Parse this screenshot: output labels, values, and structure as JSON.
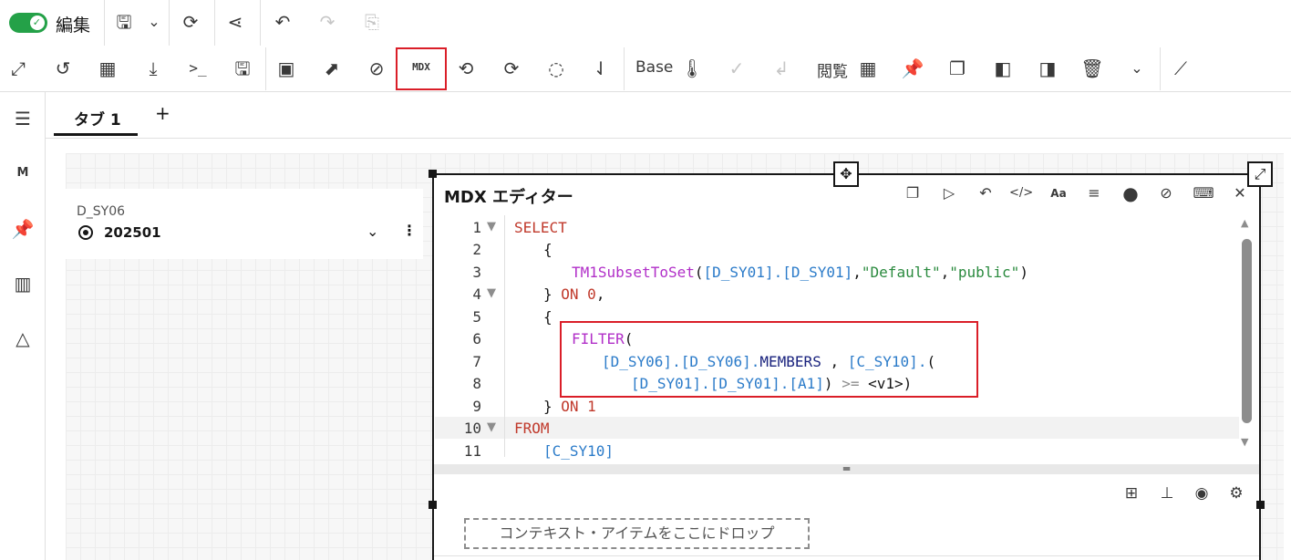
{
  "toolbar_top": {
    "edit_toggle_label": "編集",
    "edit_toggle_on": true
  },
  "toolbar_second": {
    "mdx_label": "MDX",
    "base_label": "Base",
    "browse_label": "閲覧"
  },
  "tabs": [
    {
      "label": "タブ 1",
      "active": true
    }
  ],
  "tab_add": "+",
  "selector_widget": {
    "dimension": "D_SY06",
    "value": "202501"
  },
  "mdx_editor": {
    "title": "MDX エディター",
    "line_numbers": [
      "1",
      "2",
      "3",
      "4",
      "5",
      "6",
      "7",
      "8",
      "9",
      "10",
      "11"
    ],
    "drop_zone": "コンテキスト・アイテムをここにドロップ"
  },
  "colors": {
    "accent_toggle": "#24a148",
    "highlight_red": "#da1e28",
    "keyword": "#c0392b",
    "function": "#b12fc8",
    "identifier": "#2b7bc9",
    "string": "#2a8a3e"
  }
}
